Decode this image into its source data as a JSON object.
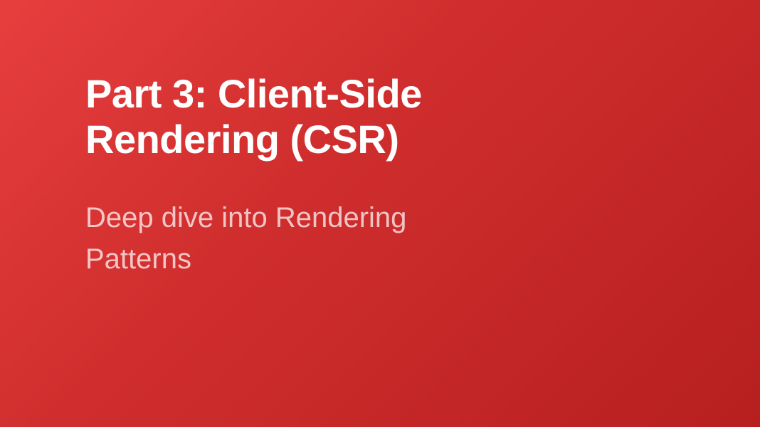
{
  "slide": {
    "title": "Part 3: Client-Side Rendering (CSR)",
    "subtitle": "Deep dive into Rendering Patterns"
  }
}
